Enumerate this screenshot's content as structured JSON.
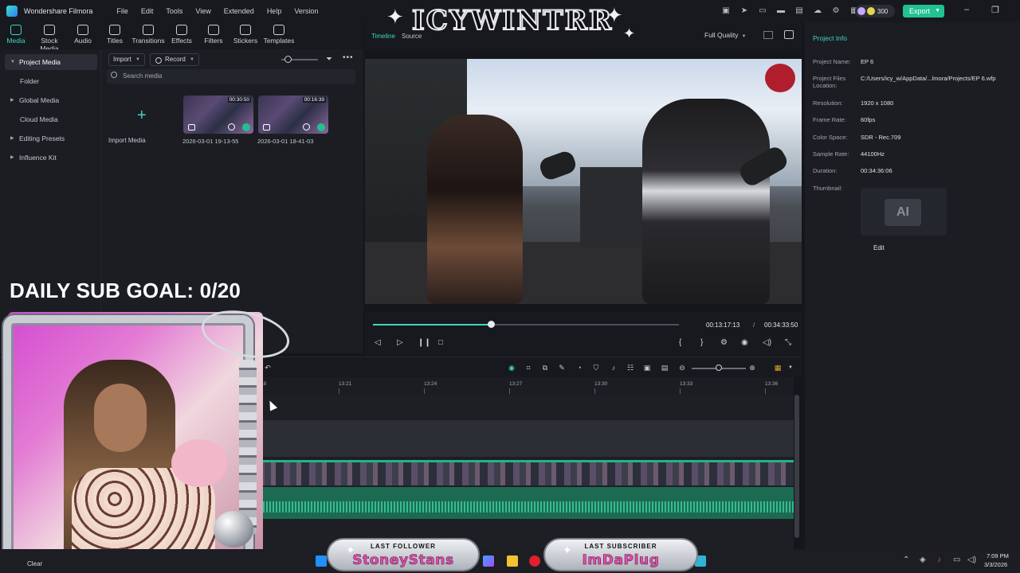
{
  "app": {
    "name": "Wondershare Filmora",
    "menu": [
      "File",
      "Edit",
      "Tools",
      "View",
      "Extended",
      "Help",
      "Version"
    ],
    "credits": "300",
    "export_label": "Export"
  },
  "toolbar": {
    "tabs": [
      "Media",
      "Stock Media",
      "Audio",
      "Titles",
      "Transitions",
      "Effects",
      "Filters",
      "Stickers",
      "Templates"
    ]
  },
  "media": {
    "nav": [
      "Project Media",
      "Folder",
      "Global Media",
      "Cloud Media",
      "Editing Presets",
      "Influence Kit"
    ],
    "import_label": "Import",
    "record_label": "Record",
    "search_placeholder": "Search media",
    "import_media_label": "Import Media",
    "clips": [
      {
        "name": "2026-03-01 19-13-55",
        "duration": "00:30:50"
      },
      {
        "name": "2026-03-01 18-41-03",
        "duration": "00:16:39"
      }
    ]
  },
  "overlay": {
    "goal": "DAILY SUB GOAL: 0/20",
    "stream_logo": "ICYWINTRR",
    "last_follower_title": "LAST FOLLOWER",
    "last_follower": "StoneyStans",
    "last_subscriber_title": "LAST SUBSCRIBER",
    "last_subscriber": "ImDaPlug",
    "clear_label": "Clear"
  },
  "preview": {
    "tab_timeline": "Timeline",
    "tab_source": "Source",
    "quality": "Full Quality",
    "current_time": "00:13:17:13",
    "total_time": "00:34:33:50",
    "progress": 0.385
  },
  "project_info": {
    "title": "Project Info",
    "rows": [
      {
        "label": "Project Name:",
        "value": "EP 6"
      },
      {
        "label": "Project Files Location:",
        "value": "C:/Users/icy_w/AppData/...lmora/Projects/EP 6.wfp"
      },
      {
        "label": "Resolution:",
        "value": "1920 x 1080"
      },
      {
        "label": "Frame Rate:",
        "value": "60fps"
      },
      {
        "label": "Color Space:",
        "value": "SDR - Rec.709"
      },
      {
        "label": "Sample Rate:",
        "value": "44100Hz"
      },
      {
        "label": "Duration:",
        "value": "00:34:36:06"
      }
    ],
    "thumbnail_label": "Thumbnail:",
    "thumbnail_text": "AI",
    "edit_label": "Edit"
  },
  "timeline": {
    "ticks": [
      "13:18",
      "13:21",
      "13:24",
      "13:27",
      "13:30",
      "13:33",
      "13:36"
    ]
  },
  "clock": {
    "time": "7:09 PM",
    "date": "3/3/2026"
  }
}
